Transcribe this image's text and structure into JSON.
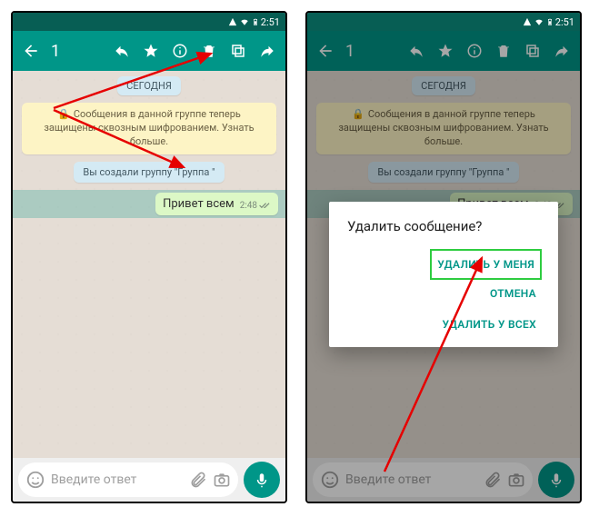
{
  "status": {
    "time": "2:51"
  },
  "appbar": {
    "count": "1"
  },
  "chat": {
    "date": "СЕГОДНЯ",
    "encryption_prefix": "🔒",
    "encryption": "Сообщения в данной группе теперь защищены сквозным шифрованием. Узнать больше.",
    "system_msg": "Вы создали группу \"Группа \"",
    "message_text": "Привет всем",
    "message_time": "2:48"
  },
  "input": {
    "placeholder": "Введите ответ"
  },
  "dialog": {
    "title": "Удалить сообщение?",
    "delete_me": "УДАЛИТЬ У МЕНЯ",
    "cancel": "ОТМЕНА",
    "delete_all": "УДАЛИТЬ У ВСЕХ"
  }
}
